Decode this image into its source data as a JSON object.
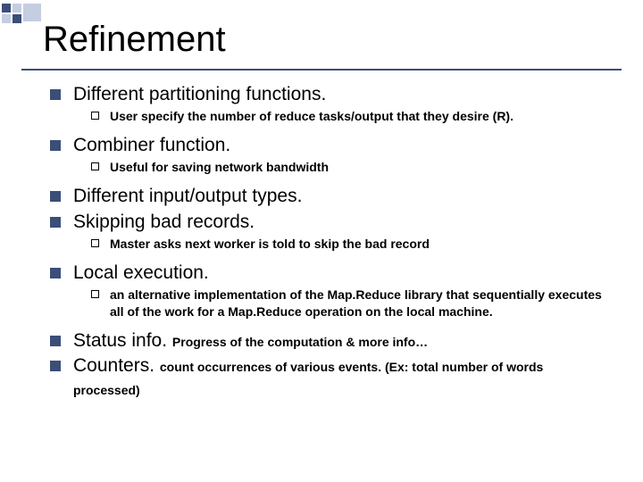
{
  "title": "Refinement",
  "items": [
    {
      "text": "Different partitioning functions.",
      "sub": [
        {
          "text": "User specify the number of reduce tasks/output that they desire (R)."
        }
      ]
    },
    {
      "text": "Combiner function.",
      "sub": [
        {
          "text": "Useful for saving network bandwidth"
        }
      ]
    },
    {
      "text": "Different input/output types."
    },
    {
      "text": "Skipping bad records.",
      "sub": [
        {
          "text": "Master asks next worker is told to skip the bad record"
        }
      ]
    },
    {
      "text": "Local execution.",
      "sub": [
        {
          "text": "an alternative implementation of the Map.Reduce library that sequentially executes all of the work for a Map.Reduce operation on the local machine."
        }
      ]
    },
    {
      "text": "Status info.",
      "inline": "Progress of the computation & more info…"
    },
    {
      "text": "Counters.",
      "inline": "count occurrences of various events. (Ex: total number of words processed)"
    }
  ]
}
